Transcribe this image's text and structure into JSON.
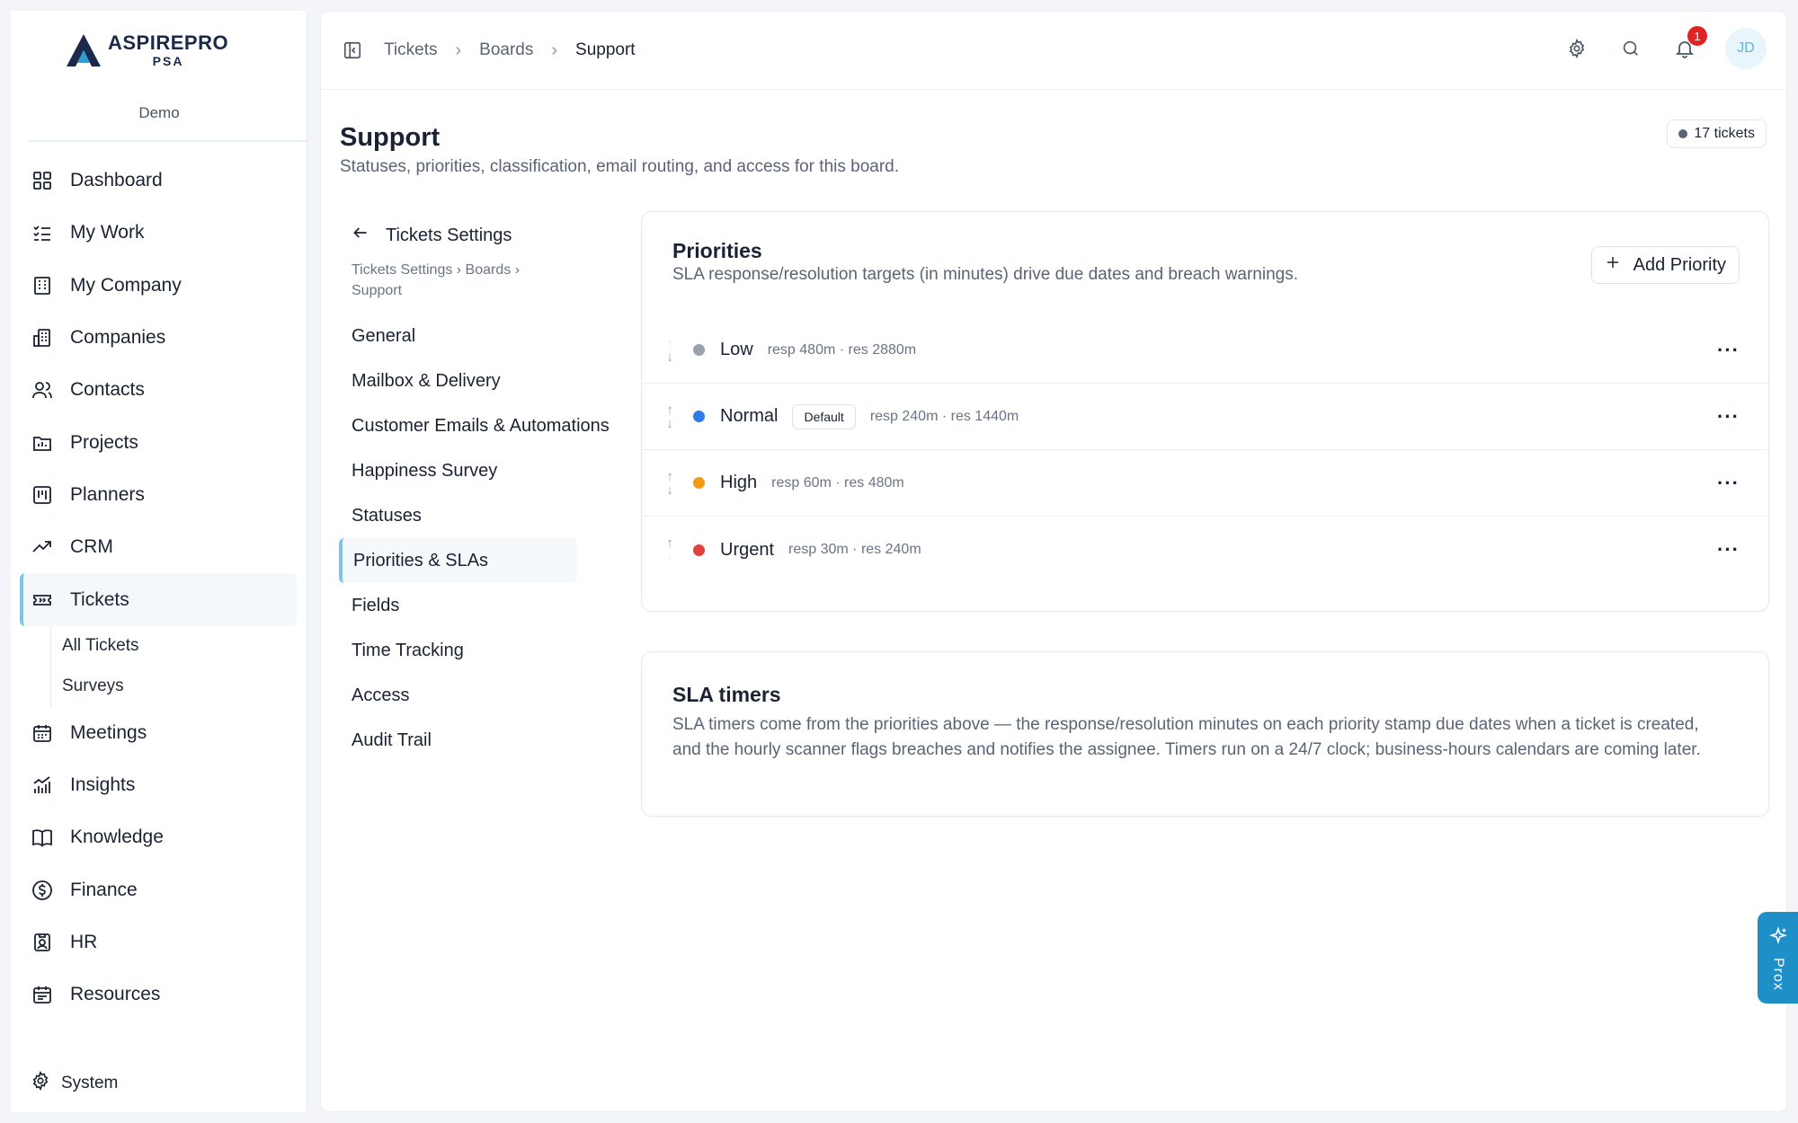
{
  "brand": {
    "name": "ASPIREPRO",
    "sub": "PSA",
    "org": "Demo"
  },
  "sidebar": {
    "items": [
      {
        "label": "Dashboard",
        "icon": "dashboard-icon"
      },
      {
        "label": "My Work",
        "icon": "my-work-icon"
      },
      {
        "label": "My Company",
        "icon": "building-icon"
      },
      {
        "label": "Companies",
        "icon": "companies-icon"
      },
      {
        "label": "Contacts",
        "icon": "contacts-icon"
      },
      {
        "label": "Projects",
        "icon": "projects-icon"
      },
      {
        "label": "Planners",
        "icon": "planners-icon"
      },
      {
        "label": "CRM",
        "icon": "trend-icon"
      },
      {
        "label": "Tickets",
        "icon": "ticket-icon",
        "active": true
      },
      {
        "label": "Meetings",
        "icon": "calendar-icon"
      },
      {
        "label": "Insights",
        "icon": "insights-icon"
      },
      {
        "label": "Knowledge",
        "icon": "book-icon"
      },
      {
        "label": "Finance",
        "icon": "dollar-icon"
      },
      {
        "label": "HR",
        "icon": "badge-icon"
      },
      {
        "label": "Resources",
        "icon": "resources-icon"
      }
    ],
    "sub_items": [
      "All Tickets",
      "Surveys"
    ],
    "bottom": "System"
  },
  "topbar": {
    "breadcrumbs": [
      "Tickets",
      "Boards",
      "Support"
    ],
    "notifications": "1",
    "avatar": "JD"
  },
  "page": {
    "title": "Support",
    "subtitle": "Statuses, priorities, classification, email routing, and access for this board.",
    "ticket_count": "17 tickets"
  },
  "settings_nav": {
    "back_label": "Tickets Settings",
    "crumb": "Tickets Settings › Boards › Support",
    "items": [
      "General",
      "Mailbox & Delivery",
      "Customer Emails & Automations",
      "Happiness Survey",
      "Statuses",
      "Priorities & SLAs",
      "Fields",
      "Time Tracking",
      "Access",
      "Audit Trail"
    ],
    "active": "Priorities & SLAs"
  },
  "priorities": {
    "title": "Priorities",
    "subtitle": "SLA response/resolution targets (in minutes) drive due dates and breach warnings.",
    "add_label": "Add Priority",
    "rows": [
      {
        "name": "Low",
        "color": "#9aa2ad",
        "meta": "resp 480m · res 2880m",
        "default": ""
      },
      {
        "name": "Normal",
        "color": "#2f7be5",
        "meta": "resp 240m · res 1440m",
        "default": "Default"
      },
      {
        "name": "High",
        "color": "#f29a11",
        "meta": "resp 60m · res 480m",
        "default": ""
      },
      {
        "name": "Urgent",
        "color": "#e0413a",
        "meta": "resp 30m · res 240m",
        "default": ""
      }
    ]
  },
  "sla": {
    "title": "SLA timers",
    "body": "SLA timers come from the priorities above — the response/resolution minutes on each priority stamp due dates when a ticket is created, and the hourly scanner flags breaches and notifies the assignee. Timers run on a 24/7 clock; business-hours calendars are coming later."
  },
  "assistant": {
    "label": "Prox"
  },
  "colors": {
    "accent": "#7cc6e2",
    "prox": "#1e8fc7",
    "badge": "#e02424"
  }
}
